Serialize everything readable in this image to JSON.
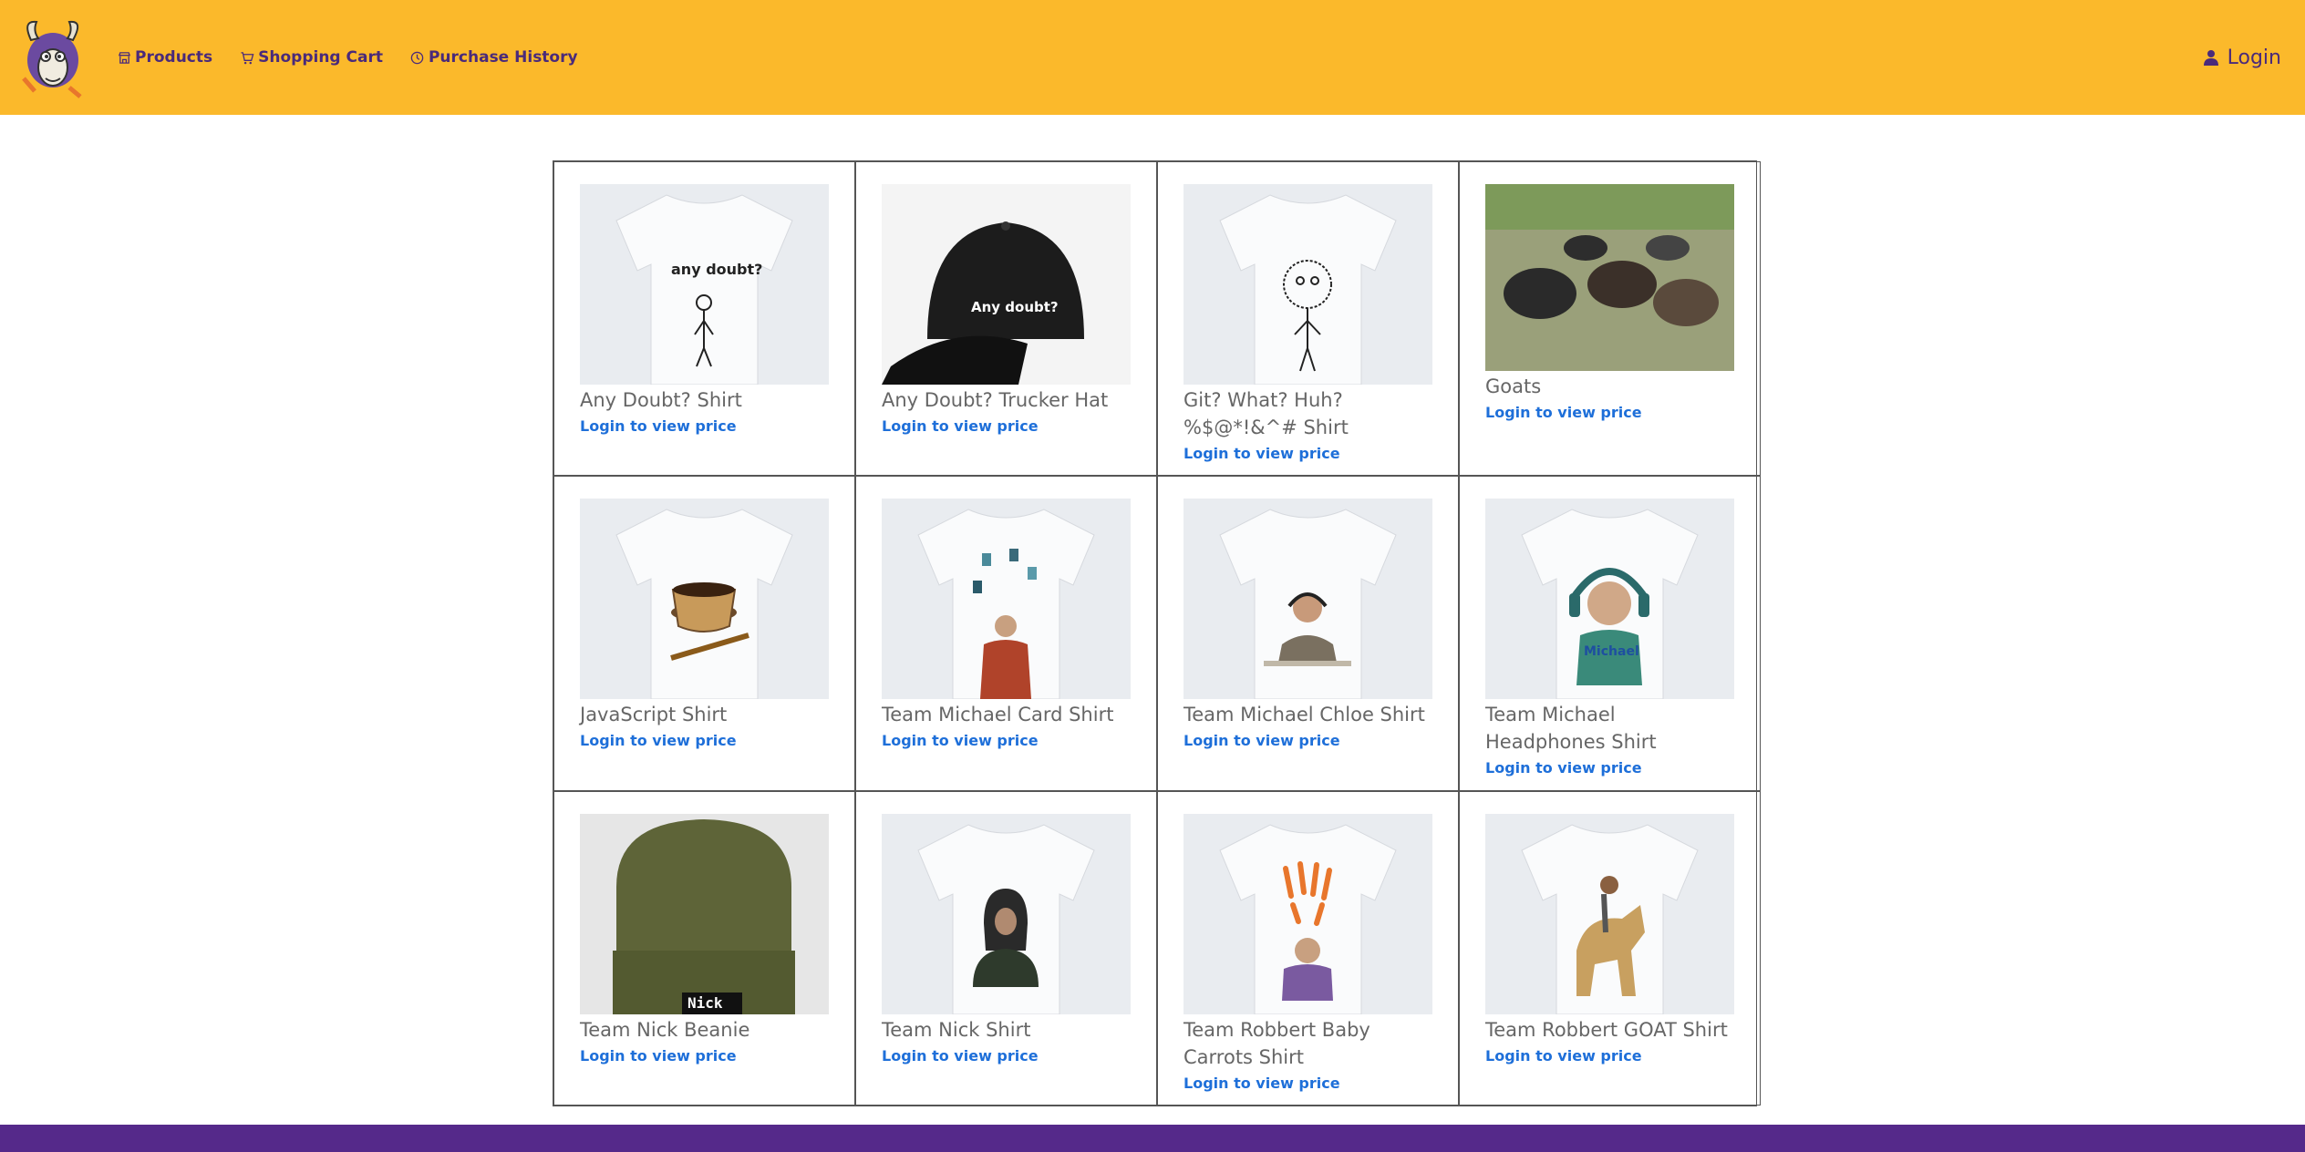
{
  "nav": {
    "items": [
      {
        "label": "Products",
        "icon": "store-icon"
      },
      {
        "label": "Shopping Cart",
        "icon": "cart-icon"
      },
      {
        "label": "Purchase History",
        "icon": "clock-icon"
      }
    ],
    "login_label": "Login"
  },
  "colors": {
    "header": "#fbb92b",
    "nav_text": "#4a2a7a",
    "link": "#1e6fd9",
    "footer": "#55298a"
  },
  "products": [
    {
      "name": "Any Doubt? Shirt",
      "price_link": "Login to view price",
      "art": "any doubt?"
    },
    {
      "name": "Any Doubt? Trucker Hat",
      "price_link": "Login to view price",
      "art": "Any doubt?"
    },
    {
      "name": "Git? What? Huh? %$@*!&^# Shirt",
      "price_link": "Login to view price"
    },
    {
      "name": "Goats",
      "price_link": "Login to view price"
    },
    {
      "name": "JavaScript Shirt",
      "price_link": "Login to view price"
    },
    {
      "name": "Team Michael Card Shirt",
      "price_link": "Login to view price"
    },
    {
      "name": "Team Michael Chloe Shirt",
      "price_link": "Login to view price"
    },
    {
      "name": "Team Michael Headphones Shirt",
      "price_link": "Login to view price",
      "art": "Michael"
    },
    {
      "name": "Team Nick Beanie",
      "price_link": "Login to view price",
      "art": "Nick"
    },
    {
      "name": "Team Nick Shirt",
      "price_link": "Login to view price"
    },
    {
      "name": "Team Robbert Baby Carrots Shirt",
      "price_link": "Login to view price"
    },
    {
      "name": "Team Robbert GOAT Shirt",
      "price_link": "Login to view price"
    }
  ]
}
